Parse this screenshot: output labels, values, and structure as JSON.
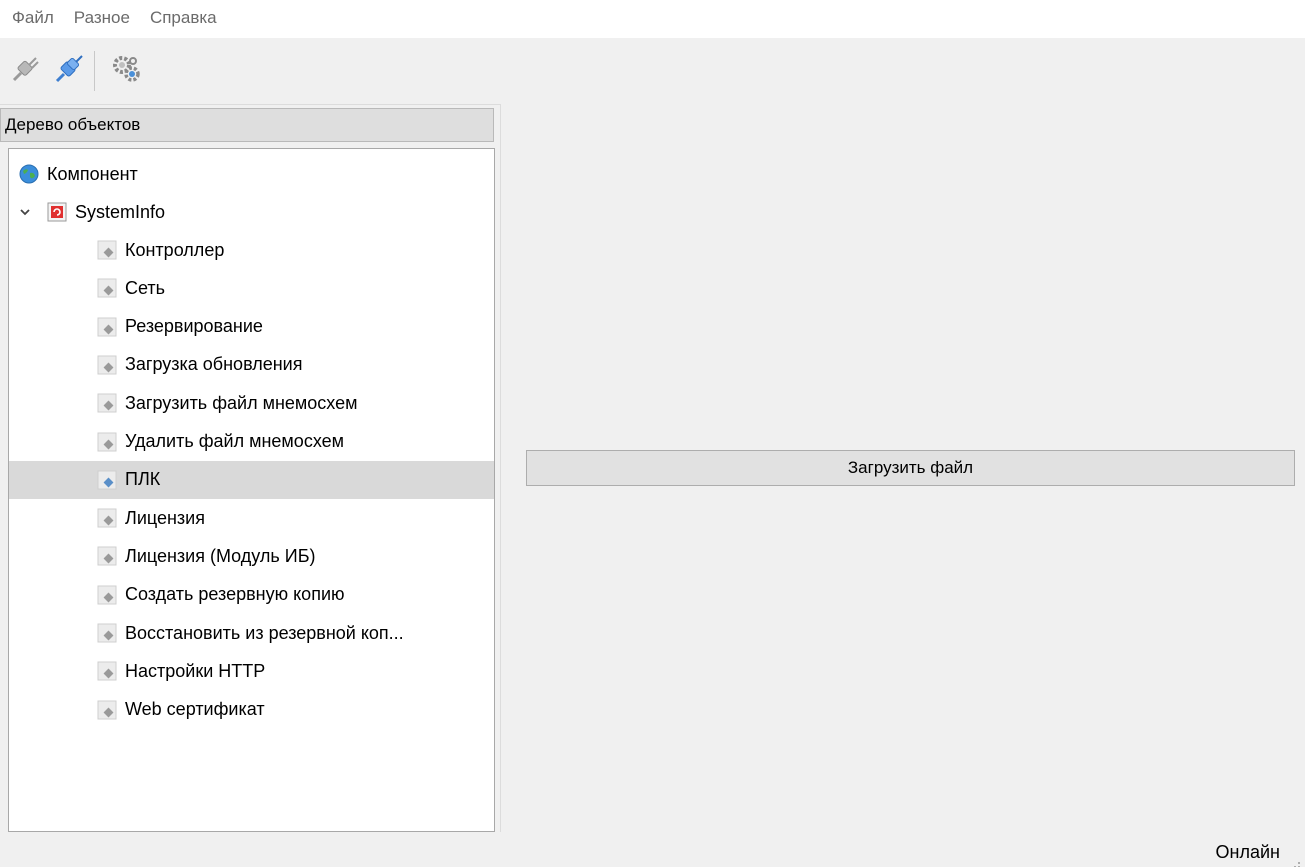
{
  "menu": [
    "Файл",
    "Разное",
    "Справка"
  ],
  "toolbar": {
    "buttons": [
      "disconnect-plug-icon",
      "connect-plug-icon",
      "settings-gears-icon"
    ]
  },
  "tree": {
    "header": "Дерево объектов",
    "root": {
      "label": "Компонент",
      "icon": "globe-icon"
    },
    "group": {
      "label": "SystemInfo",
      "icon": "systeminfo-icon",
      "expanded": true
    },
    "items": [
      "Контроллер",
      "Сеть",
      "Резервирование",
      "Загрузка обновления",
      "Загрузить файл мнемосхем",
      "Удалить файл мнемосхем",
      "ПЛК",
      "Лицензия",
      "Лицензия (Модуль ИБ)",
      "Создать резервную копию",
      "Восстановить из резервной коп...",
      "Настройки HTTP",
      "Web сертификат"
    ],
    "selected": "ПЛК"
  },
  "main": {
    "load_button_label": "Загрузить файл"
  },
  "status": {
    "text": "Онлайн"
  },
  "colors": {
    "selected_row": "#d9d9d9",
    "menu_text": "#6b6b6b",
    "item_icon": "#9a9a9a",
    "selected_icon": "#5a8fc8"
  }
}
